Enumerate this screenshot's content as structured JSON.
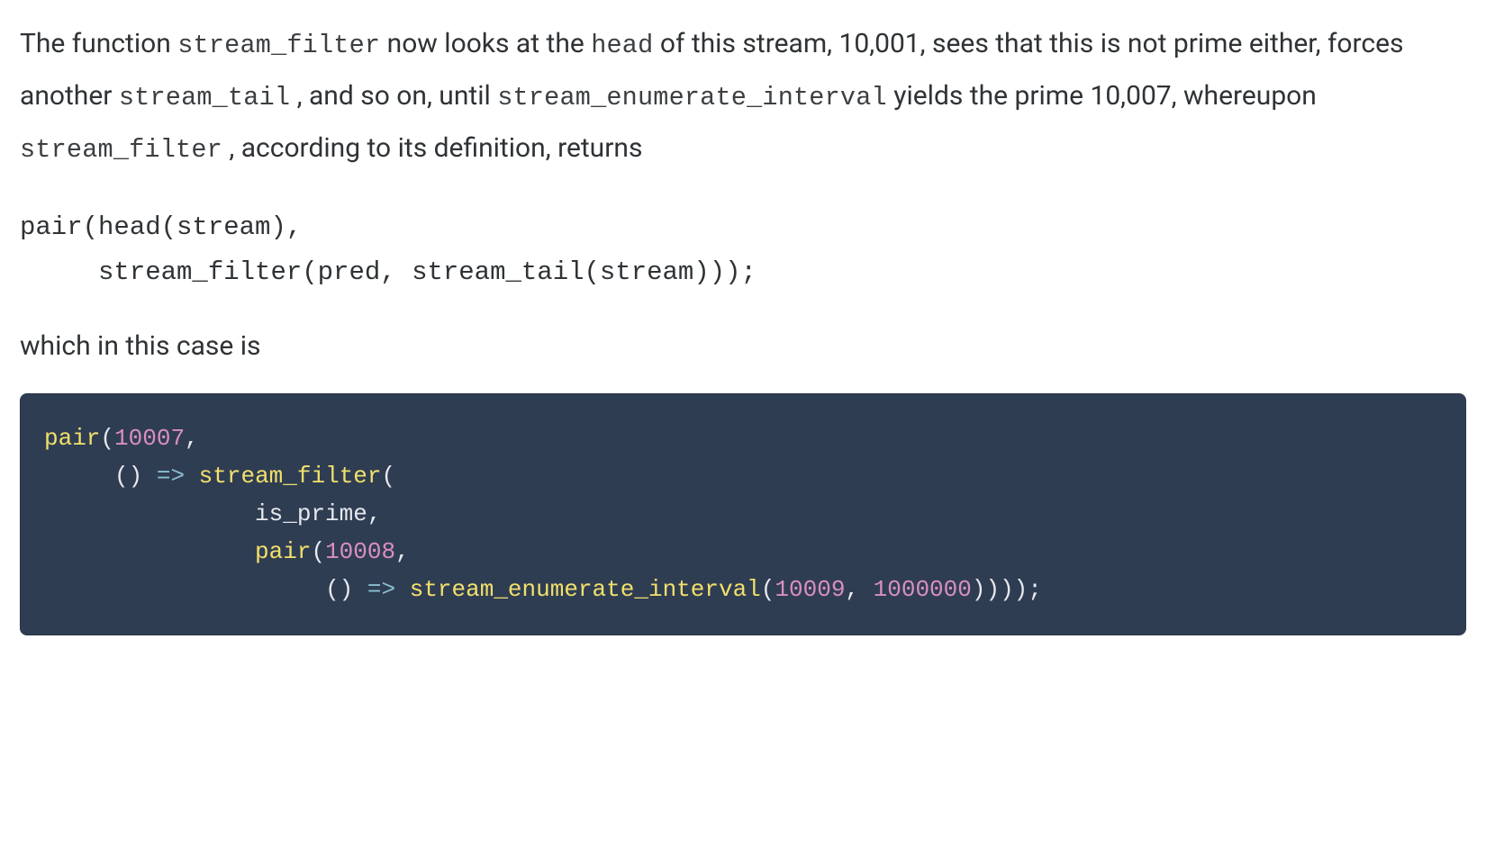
{
  "para1": {
    "t1": "The function ",
    "c1": "stream_filter",
    "t2": " now looks at the ",
    "c2": "head",
    "t3": " of this stream, 10,001, sees that this is not prime either, forces another ",
    "c3": "stream_tail",
    "t4": " , and so on, until ",
    "c4": "stream_enumerate_interval",
    "t5": " yields the prime 10,007, whereupon ",
    "c5": "stream_filter",
    "t6": " , according to its definition, returns"
  },
  "code1": {
    "line1": "pair(head(stream),",
    "line2": "     stream_filter(pred, stream_tail(stream)));"
  },
  "para2": "which in this case is",
  "code2": {
    "fn_pair": "pair",
    "lp": "(",
    "rp": ")",
    "comma": ",",
    "n_10007": "10007",
    "empty_parens": "()",
    "arrow": "=>",
    "fn_stream_filter": "stream_filter",
    "id_is_prime": "is_prime",
    "n_10008": "10008",
    "fn_stream_enum": "stream_enumerate_interval",
    "n_10009": "10009",
    "n_1000000": "1000000",
    "close4": "))));",
    "semi": ";",
    "sp5": "     ",
    "sp15": "               ",
    "sp20": "                    "
  }
}
